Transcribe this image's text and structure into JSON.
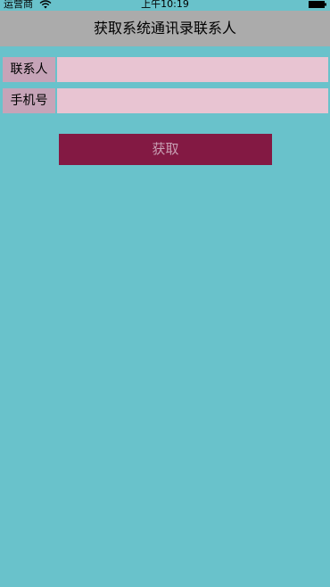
{
  "status_bar": {
    "carrier": "运营商",
    "time": "上午10:19",
    "wifi_icon": "wifi-icon",
    "battery_icon": "battery-icon"
  },
  "nav": {
    "title": "获取系统通讯录联系人"
  },
  "form": {
    "contact_label": "联系人",
    "contact_value": "",
    "phone_label": "手机号",
    "phone_value": ""
  },
  "fetch_button": {
    "label": "获取"
  },
  "colors": {
    "background": "#69C2CB",
    "nav_bar": "#ABABAB",
    "label_bg": "#C6A4B8",
    "input_bg": "#E8C4D2",
    "button_bg": "#831943",
    "button_text": "#C8A0B4"
  }
}
